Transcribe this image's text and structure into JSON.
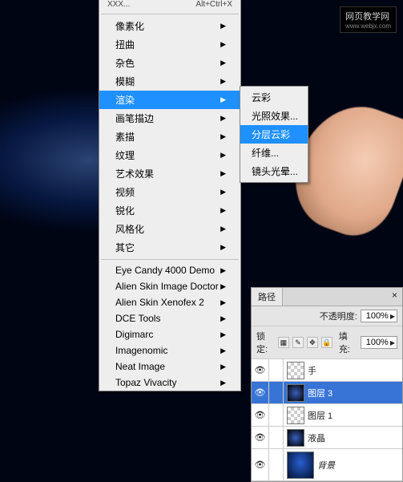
{
  "watermark": {
    "title": "网页教学网",
    "url": "www.webjx.com"
  },
  "menu": {
    "top_left": "XXX...",
    "top_right": "Alt+Ctrl+X",
    "items": [
      {
        "label": "像素化",
        "arrow": true
      },
      {
        "label": "扭曲",
        "arrow": true
      },
      {
        "label": "杂色",
        "arrow": true
      },
      {
        "label": "模糊",
        "arrow": true
      },
      {
        "label": "渲染",
        "arrow": true,
        "selected": true
      },
      {
        "label": "画笔描边",
        "arrow": true
      },
      {
        "label": "素描",
        "arrow": true
      },
      {
        "label": "纹理",
        "arrow": true
      },
      {
        "label": "艺术效果",
        "arrow": true
      },
      {
        "label": "视频",
        "arrow": true
      },
      {
        "label": "锐化",
        "arrow": true
      },
      {
        "label": "风格化",
        "arrow": true
      },
      {
        "label": "其它",
        "arrow": true
      }
    ],
    "plugins": [
      {
        "label": "Eye Candy 4000 Demo",
        "arrow": true
      },
      {
        "label": "Alien Skin Image Doctor",
        "arrow": true
      },
      {
        "label": "Alien Skin Xenofex 2",
        "arrow": true
      },
      {
        "label": "DCE Tools",
        "arrow": true
      },
      {
        "label": "Digimarc",
        "arrow": true
      },
      {
        "label": "Imagenomic",
        "arrow": true
      },
      {
        "label": "Neat Image",
        "arrow": true
      },
      {
        "label": "Topaz Vivacity",
        "arrow": true
      }
    ]
  },
  "submenu": {
    "items": [
      {
        "label": "云彩"
      },
      {
        "label": "光照效果..."
      },
      {
        "label": "分层云彩",
        "selected": true
      },
      {
        "label": "纤维..."
      },
      {
        "label": "镜头光晕..."
      }
    ]
  },
  "layers": {
    "tab_paths": "路径",
    "close": "×",
    "opacity_label": "不透明度:",
    "opacity_value": "100%",
    "lock_label": "锁定:",
    "fill_label": "填充:",
    "fill_value": "100%",
    "rows": [
      {
        "name": "手",
        "thumb": "checker"
      },
      {
        "name": "图层 3",
        "thumb": "dark",
        "selected": true
      },
      {
        "name": "图层 1",
        "thumb": "checker"
      },
      {
        "name": "液晶",
        "thumb": "dark"
      },
      {
        "name": "背景",
        "thumb": "blue",
        "italic": true,
        "tall": true
      }
    ]
  }
}
